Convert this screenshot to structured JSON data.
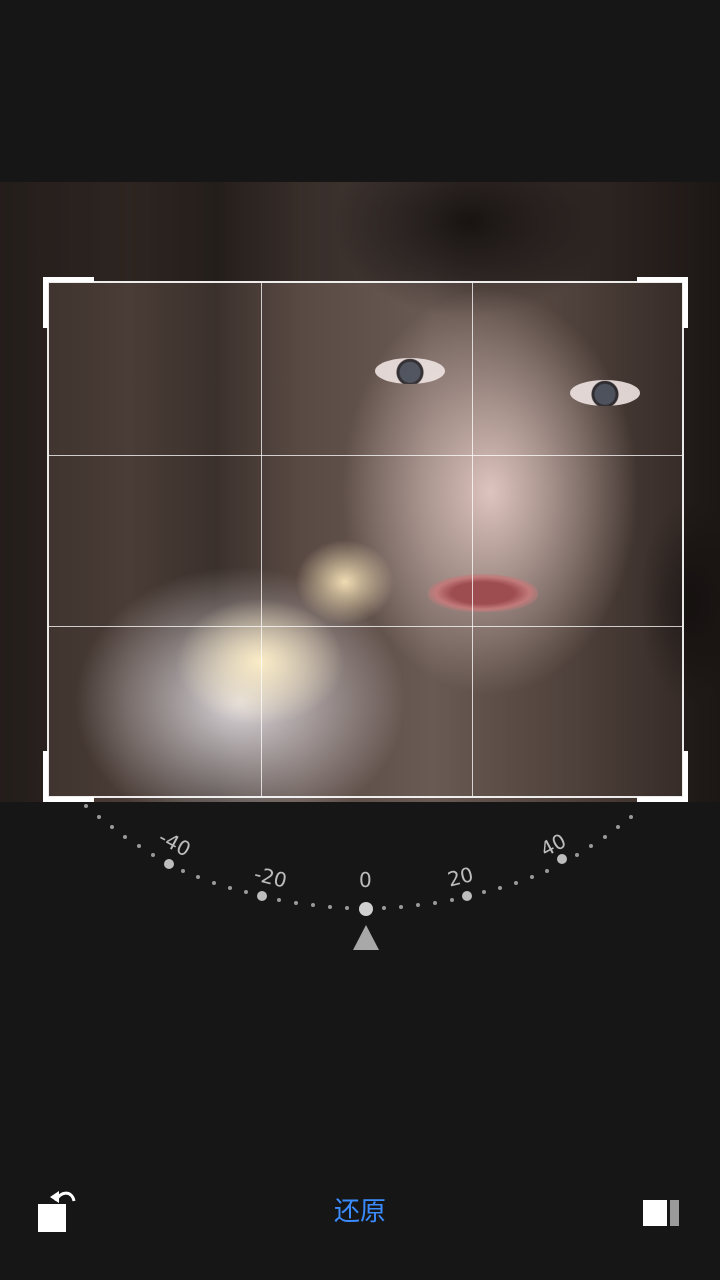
{
  "toolbar": {
    "reset_label": "还原",
    "rotate_icon": "rotate-left-icon",
    "aspect_icon": "aspect-ratio-icon",
    "accent_color": "#3b8cff"
  },
  "straighten_dial": {
    "ticks": [
      "-40",
      "-20",
      "0",
      "20",
      "40"
    ],
    "current_value": 0,
    "pointer_icon": "triangle-up-icon"
  },
  "crop": {
    "grid": "3x3"
  }
}
